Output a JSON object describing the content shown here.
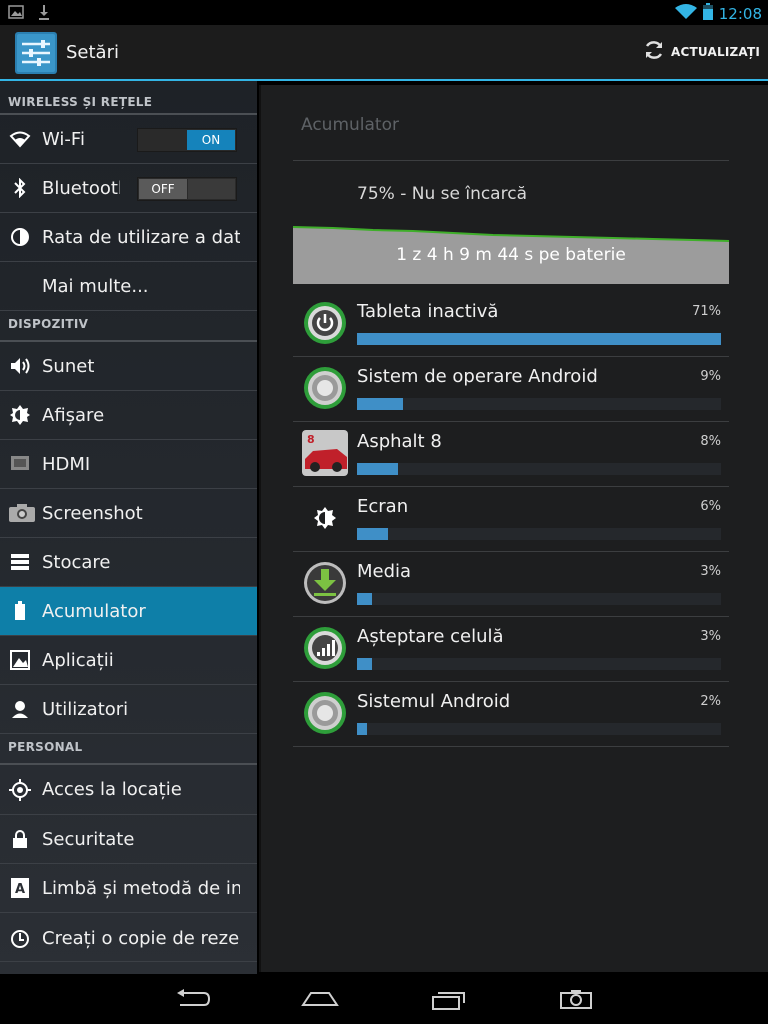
{
  "status_bar": {
    "time": "12:08",
    "icons": [
      "image-notification-icon",
      "download-notification-icon",
      "wifi-icon",
      "battery-icon"
    ]
  },
  "action_bar": {
    "title": "Setări",
    "refresh_label": "ACTUALIZAȚI",
    "accent_color": "#33b5e5"
  },
  "sidebar": {
    "sections": [
      {
        "header": "WIRELESS ȘI REȚELE",
        "items": [
          {
            "label": "Wi-Fi",
            "icon": "wifi-icon",
            "toggle": "ON"
          },
          {
            "label": "Bluetooth",
            "icon": "bluetooth-icon",
            "toggle": "OFF"
          },
          {
            "label": "Rata de utilizare a datelor",
            "icon": "data-usage-icon"
          },
          {
            "label": "Mai multe...",
            "icon": ""
          }
        ]
      },
      {
        "header": "DISPOZITIV",
        "items": [
          {
            "label": "Sunet",
            "icon": "speaker-icon"
          },
          {
            "label": "Afișare",
            "icon": "brightness-icon"
          },
          {
            "label": "HDMI",
            "icon": "hdmi-icon"
          },
          {
            "label": "Screenshot",
            "icon": "camera-icon"
          },
          {
            "label": "Stocare",
            "icon": "storage-icon"
          },
          {
            "label": "Acumulator",
            "icon": "battery-icon",
            "active": true
          },
          {
            "label": "Aplicații",
            "icon": "apps-icon"
          },
          {
            "label": "Utilizatori",
            "icon": "user-icon"
          }
        ]
      },
      {
        "header": "PERSONAL",
        "items": [
          {
            "label": "Acces la locație",
            "icon": "location-icon"
          },
          {
            "label": "Securitate",
            "icon": "lock-icon"
          },
          {
            "label": "Limbă și metodă de introducere",
            "icon": "keyboard-language-icon"
          },
          {
            "label": "Creați o copie de rezervă",
            "icon": "backup-icon"
          }
        ]
      }
    ],
    "active_color": "#0e7fa8"
  },
  "detail": {
    "title": "Acumulator",
    "status": "75% - Nu se încarcă",
    "graph_label": "1 z 4 h 9 m 44 s pe baterie",
    "usage": [
      {
        "name": "Tableta inactivă",
        "percent": 71,
        "percent_text": "71%",
        "icon": "power-idle-icon"
      },
      {
        "name": "Sistem de operare Android",
        "percent": 9,
        "percent_text": "9%",
        "icon": "android-os-icon"
      },
      {
        "name": "Asphalt 8",
        "percent": 8,
        "percent_text": "8%",
        "icon": "asphalt-8-app-icon"
      },
      {
        "name": "Ecran",
        "percent": 6,
        "percent_text": "6%",
        "icon": "screen-brightness-icon"
      },
      {
        "name": "Media",
        "percent": 3,
        "percent_text": "3%",
        "icon": "media-download-icon"
      },
      {
        "name": "Așteptare celulă",
        "percent": 3,
        "percent_text": "3%",
        "icon": "cell-standby-icon"
      },
      {
        "name": "Sistemul Android",
        "percent": 2,
        "percent_text": "2%",
        "icon": "android-system-icon"
      }
    ],
    "bar_color": "#3f8fc7"
  },
  "nav_bar": {
    "buttons": [
      "back-icon",
      "home-icon",
      "recent-apps-icon",
      "screenshot-button-icon"
    ]
  }
}
